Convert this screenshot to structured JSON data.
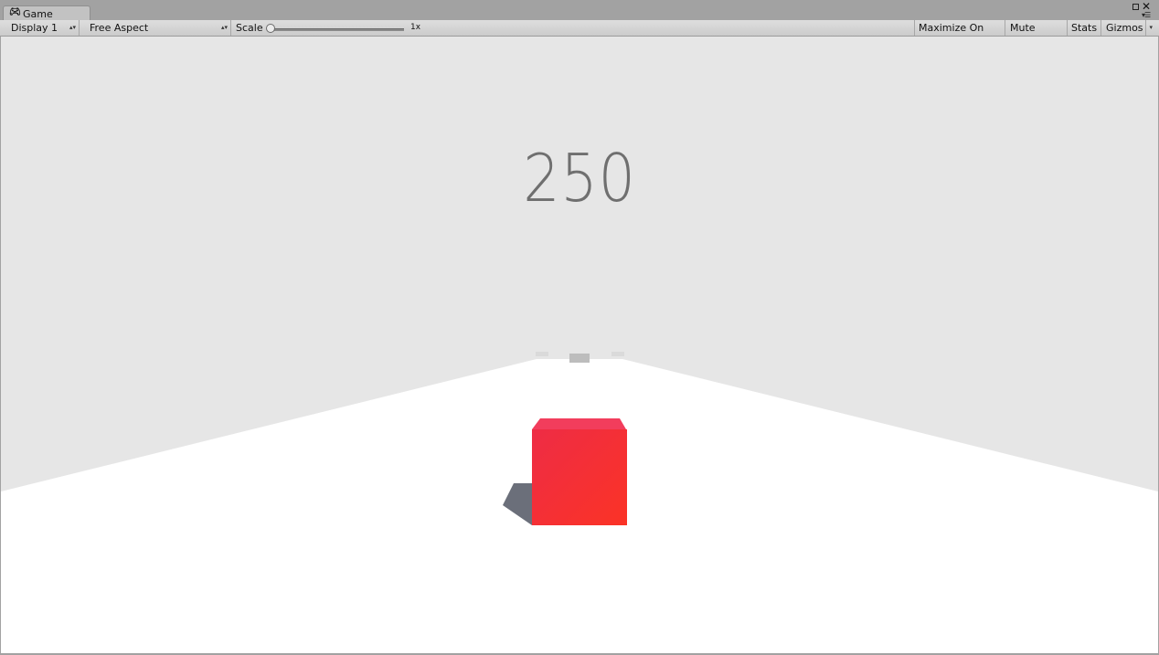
{
  "window": {
    "tab_label": "Game",
    "tab_icon": "game-controller-icon"
  },
  "toolbar": {
    "display_label": "Display 1",
    "aspect_label": "Free Aspect",
    "scale_label": "Scale",
    "scale_value_label": "1x",
    "scale_value": 1,
    "maximize_label": "Maximize On Play",
    "mute_label": "Mute Audio",
    "stats_label": "Stats",
    "gizmos_label": "Gizmos"
  },
  "game": {
    "score": "250",
    "player_color": "#f0303a",
    "ground_color": "#ffffff",
    "sky_color": "#e6e6e6",
    "obstacle_color": "#bdbdbd"
  }
}
